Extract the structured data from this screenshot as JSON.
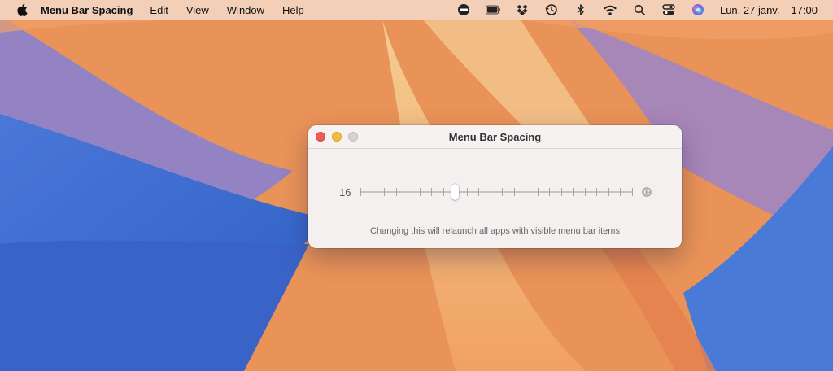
{
  "menubar": {
    "app_name": "Menu Bar Spacing",
    "menus": [
      "Edit",
      "View",
      "Window",
      "Help"
    ],
    "status_icons": [
      "nfc-badge-icon",
      "battery-icon",
      "dropbox-icon",
      "time-machine-icon",
      "bluetooth-icon",
      "wifi-icon",
      "search-icon",
      "control-center-icon",
      "siri-icon"
    ],
    "date": "Lun. 27 janv.",
    "time": "17:00"
  },
  "window": {
    "title": "Menu Bar Spacing",
    "slider": {
      "value_label": "16",
      "tick_count": 24,
      "selected_index": 8
    },
    "reset_icon": "reset-icon",
    "note": "Changing this will relaunch all apps with visible menu bar items"
  }
}
